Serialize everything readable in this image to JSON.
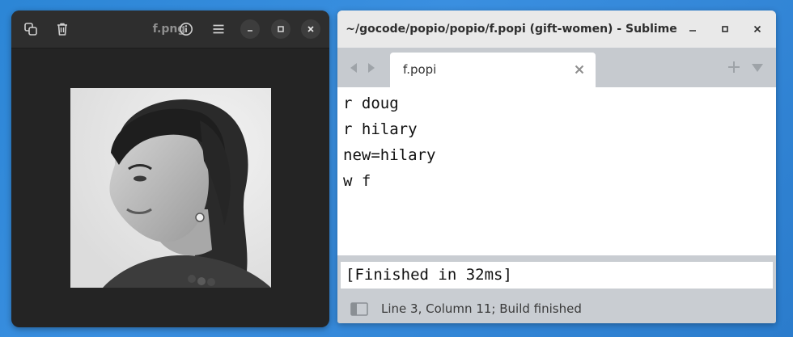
{
  "viewer": {
    "title": "f.png",
    "icons": [
      "copy-icon",
      "trash-icon",
      "info-icon",
      "menu-icon",
      "minimize-icon",
      "maximize-icon",
      "close-icon"
    ]
  },
  "sublime": {
    "title": "~/gocode/popio/popio/f.popi (gift-women) - Sublime Text",
    "tab_label": "f.popi",
    "code_lines": [
      "r doug",
      "r hilary",
      "new=hilary",
      "w f"
    ],
    "output": "[Finished in 32ms]",
    "status": "Line 3, Column 11; Build finished"
  },
  "colors": {
    "desktop": "#2c86d6",
    "viewer_bg": "#242424",
    "viewer_header": "#2e2e2e",
    "sublime_titlebar": "#e9e9e9",
    "sublime_chrome": "#c9cdd2",
    "editor_bg": "#ffffff"
  }
}
